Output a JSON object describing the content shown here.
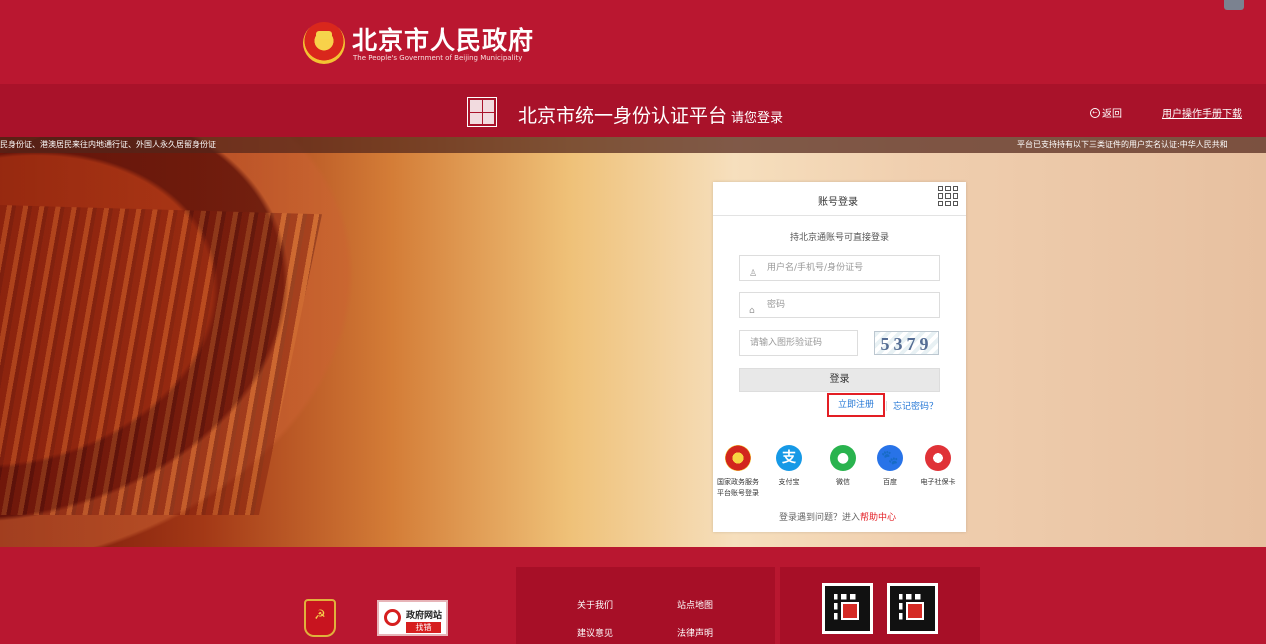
{
  "header": {
    "title": "北京市人民政府",
    "subtitle": "The People's Government of Beijing Municipality"
  },
  "platform": {
    "title": "北京市统一身份认证平台",
    "subtitle": "请您登录",
    "back": "返回",
    "manual": "用户操作手册下载"
  },
  "ticker": {
    "left": "民身份证、港澳居民来往内地通行证、外国人永久居留身份证",
    "right": "平台已支持持有以下三类证件的用户实名认证:中华人民共和"
  },
  "login": {
    "tab": "账号登录",
    "note": "持北京通账号可直接登录",
    "username_placeholder": "用户名/手机号/身份证号",
    "password_placeholder": "密码",
    "captcha_placeholder": "请输入图形验证码",
    "captcha_code": "5379",
    "button": "登录",
    "register": "立即注册",
    "forgot": "忘记密码？",
    "help_prefix": "登录遇到问题？进入",
    "help_link": "帮助中心"
  },
  "providers": [
    {
      "label": "国家政务服务\n平台账号登录"
    },
    {
      "label": "支付宝",
      "icon": "支"
    },
    {
      "label": "微信",
      "icon": "●"
    },
    {
      "label": "百度",
      "icon": "🐾"
    },
    {
      "label": "电子社保卡"
    }
  ],
  "footer": {
    "error_title": "政府网站",
    "error_sub": "找错",
    "links": [
      "关于我们",
      "站点地图",
      "建议意见",
      "法律声明"
    ]
  },
  "colors": {
    "primary": "#ba1730",
    "link": "#2678d6",
    "highlight": "#e31e24"
  },
  "icons": {
    "user": "user-icon",
    "lock": "lock-icon",
    "qr": "qr-code-icon",
    "back": "back-circle-icon"
  }
}
